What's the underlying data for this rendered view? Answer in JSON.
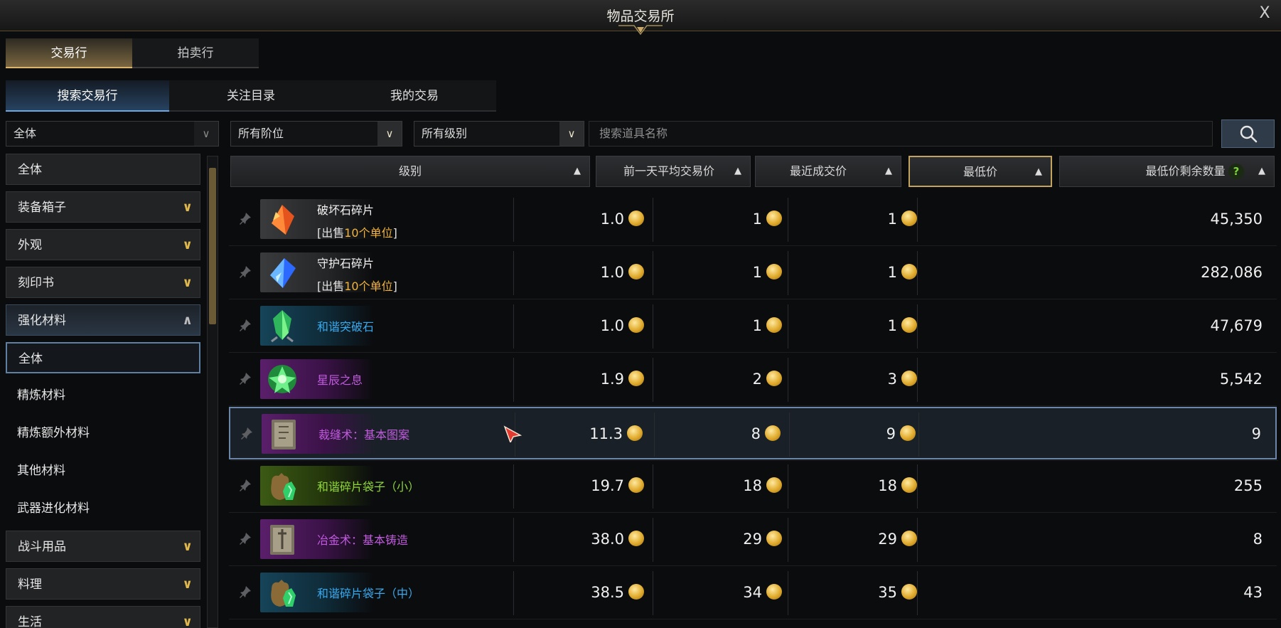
{
  "window": {
    "title": "物品交易所",
    "close_label": "X"
  },
  "main_tabs": [
    {
      "label": "交易行",
      "active": true
    },
    {
      "label": "拍卖行",
      "active": false
    }
  ],
  "sub_tabs": [
    {
      "label": "搜索交易行",
      "active": true
    },
    {
      "label": "关注目录",
      "active": false
    },
    {
      "label": "我的交易",
      "active": false
    }
  ],
  "filters": {
    "category": "全体",
    "tier": "所有阶位",
    "grade": "所有级别",
    "search_placeholder": "搜索道具名称"
  },
  "sidebar": {
    "items": [
      {
        "label": "全体",
        "style": "box"
      },
      {
        "label": "装备箱子",
        "style": "box",
        "chevron": "down"
      },
      {
        "label": "外观",
        "style": "box",
        "chevron": "down"
      },
      {
        "label": "刻印书",
        "style": "box",
        "chevron": "down"
      },
      {
        "label": "强化材料",
        "style": "open",
        "chevron": "up"
      },
      {
        "label": "全体",
        "style": "sel"
      },
      {
        "label": "精炼材料",
        "style": "plain"
      },
      {
        "label": "精炼额外材料",
        "style": "plain"
      },
      {
        "label": "其他材料",
        "style": "plain"
      },
      {
        "label": "武器进化材料",
        "style": "plain"
      },
      {
        "label": "战斗用品",
        "style": "box",
        "chevron": "down"
      },
      {
        "label": "料理",
        "style": "box",
        "chevron": "down"
      },
      {
        "label": "生活",
        "style": "box",
        "chevron": "down"
      }
    ]
  },
  "table": {
    "headers": {
      "grade": "级别",
      "avg_price": "前一天平均交易价",
      "recent_price": "最近成交价",
      "lowest_price": "最低价",
      "lowest_qty": "最低价剩余数量",
      "help": "?"
    },
    "rows": [
      {
        "name": "破坏石碎片",
        "name_color": "#f2f2f2",
        "sub_pre": "[出售",
        "sub_hi": "10个单位",
        "sub_post": "]",
        "rarity": "normal",
        "icon": "red-crystal-icon",
        "avg": "1.0",
        "recent": "1",
        "lowest": "1",
        "qty": "45,350"
      },
      {
        "name": "守护石碎片",
        "name_color": "#f2f2f2",
        "sub_pre": "[出售",
        "sub_hi": "10个单位",
        "sub_post": "]",
        "rarity": "normal",
        "icon": "blue-crystal-icon",
        "avg": "1.0",
        "recent": "1",
        "lowest": "1",
        "qty": "282,086"
      },
      {
        "name": "和谐突破石",
        "name_color": "#38a9ee",
        "rarity": "rare",
        "icon": "green-gem-icon",
        "avg": "1.0",
        "recent": "1",
        "lowest": "1",
        "qty": "47,679"
      },
      {
        "name": "星辰之息",
        "name_color": "#c25ae0",
        "rarity": "epic",
        "icon": "star-orb-icon",
        "avg": "1.9",
        "recent": "2",
        "lowest": "3",
        "qty": "5,542"
      },
      {
        "name": "裁缝术：基本图案",
        "name_color": "#c25ae0",
        "rarity": "epic",
        "icon": "book-icon",
        "avg": "11.3",
        "recent": "8",
        "lowest": "9",
        "qty": "9",
        "highlight": true
      },
      {
        "name": "和谐碎片袋子（小）",
        "name_color": "#8fd63a",
        "rarity": "uncommon",
        "icon": "pouch-icon",
        "avg": "19.7",
        "recent": "18",
        "lowest": "18",
        "qty": "255"
      },
      {
        "name": "冶金术：基本铸造",
        "name_color": "#c25ae0",
        "rarity": "epic",
        "icon": "book-sword-icon",
        "avg": "38.0",
        "recent": "29",
        "lowest": "29",
        "qty": "8"
      },
      {
        "name": "和谐碎片袋子（中）",
        "name_color": "#38a9ee",
        "rarity": "rare",
        "icon": "pouch-icon",
        "avg": "38.5",
        "recent": "34",
        "lowest": "35",
        "qty": "43"
      }
    ]
  },
  "colors": {
    "gold_accent": "#d9b46a",
    "blue_accent": "#6ea7e0",
    "chevron": "#e0b84c",
    "help": "#7ed23c"
  }
}
